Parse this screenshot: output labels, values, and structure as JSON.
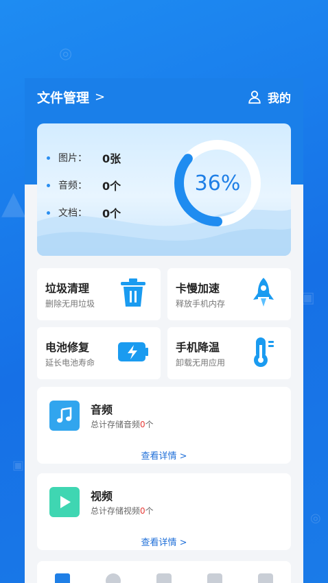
{
  "header": {
    "title": "文件管理",
    "chevron": ">",
    "mine_label": "我的"
  },
  "storage": {
    "percent_text": "36%",
    "percent_value": 0.36,
    "stats": [
      {
        "label": "图片：",
        "value": "0张"
      },
      {
        "label": "音频：",
        "value": "0个"
      },
      {
        "label": "文档：",
        "value": "0个"
      }
    ]
  },
  "tools": [
    {
      "title": "垃圾清理",
      "subtitle": "删除无用垃圾",
      "icon": "trash-icon"
    },
    {
      "title": "卡慢加速",
      "subtitle": "释放手机内存",
      "icon": "rocket-icon"
    },
    {
      "title": "电池修复",
      "subtitle": "延长电池寿命",
      "icon": "battery-icon"
    },
    {
      "title": "手机降温",
      "subtitle": "卸载无用应用",
      "icon": "thermometer-icon"
    }
  ],
  "media": [
    {
      "title": "音频",
      "sub_prefix": "总计存储音频",
      "count": "0",
      "sub_suffix": "个",
      "link": "查看详情 >",
      "icon": "music-note-icon"
    },
    {
      "title": "视频",
      "sub_prefix": "总计存储视频",
      "count": "0",
      "sub_suffix": "个",
      "link": "查看详情 >",
      "icon": "play-icon"
    }
  ],
  "colors": {
    "accent": "#1f7fe6",
    "background": "#1670e6",
    "highlight_number": "#e53935"
  }
}
